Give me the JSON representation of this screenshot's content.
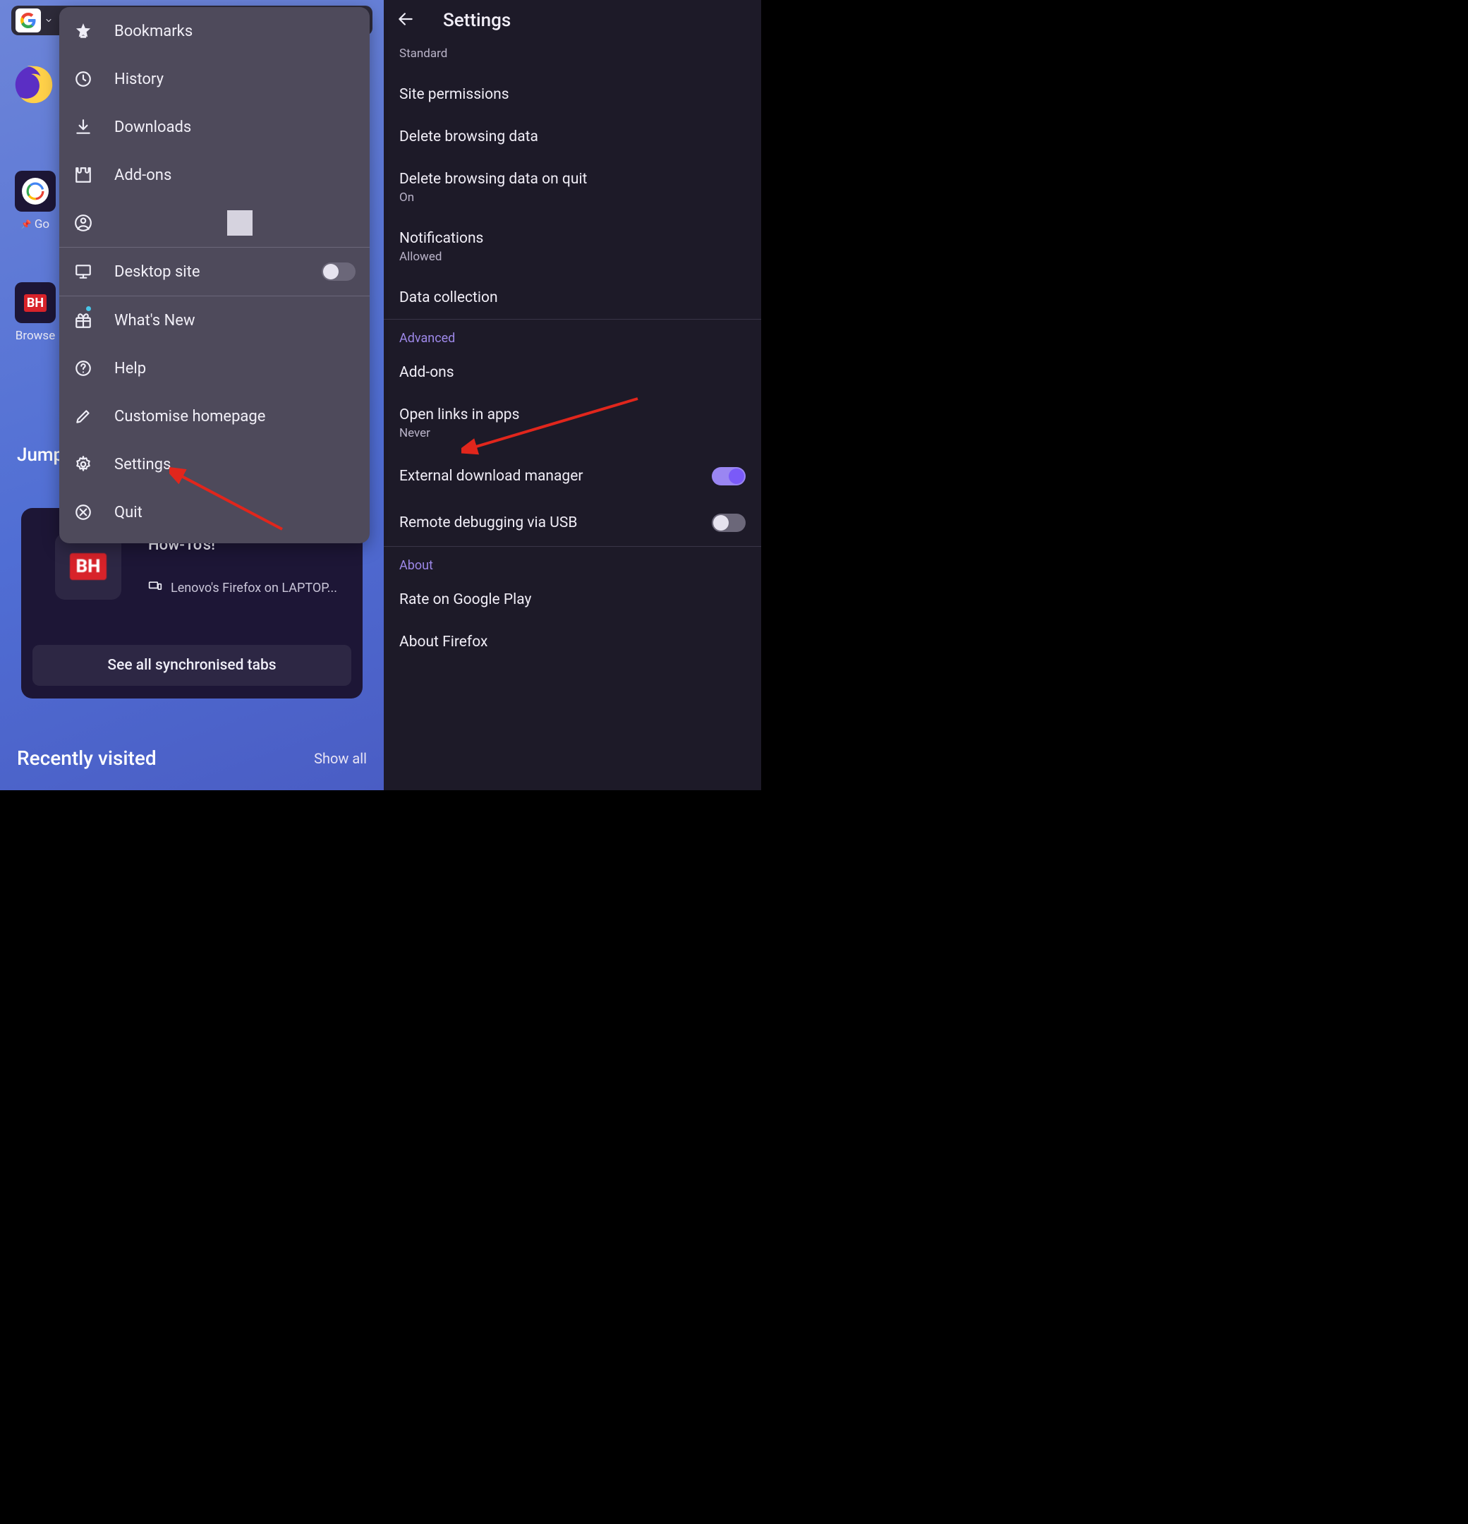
{
  "left": {
    "home": {
      "tiles": [
        {
          "label": "Go",
          "pinned": true
        },
        {
          "label": "Browse",
          "pinned": false
        }
      ],
      "jump_label": "Jump",
      "sync": {
        "title": "How-To's!",
        "device": "Lenovo's Firefox on LAPTOP...",
        "button": "See all synchronised tabs"
      },
      "recently": "Recently visited",
      "show_all": "Show all"
    },
    "menu": {
      "bookmarks": "Bookmarks",
      "history": "History",
      "downloads": "Downloads",
      "addons": "Add-ons",
      "desktop_site": "Desktop site",
      "whats_new": "What's New",
      "help": "Help",
      "customise": "Customise homepage",
      "settings": "Settings",
      "quit": "Quit"
    }
  },
  "right": {
    "title": "Settings",
    "items": {
      "standard": "Standard",
      "site_permissions": "Site permissions",
      "delete_browsing": "Delete browsing data",
      "delete_on_quit": "Delete browsing data on quit",
      "delete_on_quit_sub": "On",
      "notifications": "Notifications",
      "notifications_sub": "Allowed",
      "data_collection": "Data collection",
      "section_advanced": "Advanced",
      "addons": "Add-ons",
      "open_links": "Open links in apps",
      "open_links_sub": "Never",
      "ext_dl_mgr": "External download manager",
      "remote_debug": "Remote debugging via USB",
      "section_about": "About",
      "rate": "Rate on Google Play",
      "about_ff": "About Firefox"
    }
  }
}
